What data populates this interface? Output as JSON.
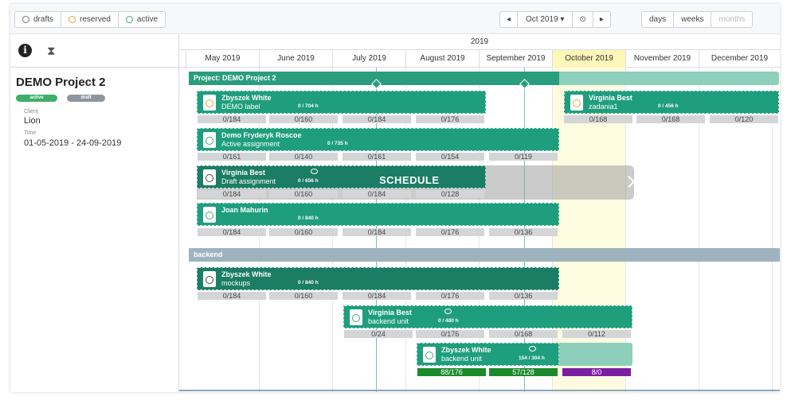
{
  "filters": {
    "drafts": "drafts",
    "reserved": "reserved",
    "active": "active"
  },
  "navigation": {
    "prev": "◂",
    "period": "Oct 2019 ▾",
    "today": "⊙",
    "next": "▸"
  },
  "zoom": {
    "days": "days",
    "weeks": "weeks",
    "months": "months"
  },
  "project": {
    "title": "DEMO Project 2",
    "status_active": "active",
    "status_draft": "draft",
    "client_label": "Client",
    "client": "Lion",
    "time_label": "Time",
    "time": "01-05-2019 - 24-09-2019"
  },
  "timeline": {
    "year": "2019",
    "months": [
      "May 2019",
      "June 2019",
      "July 2019",
      "August 2019",
      "September 2019",
      "October 2019",
      "November 2019",
      "December 2019"
    ]
  },
  "bars": {
    "project": "Project: DEMO Project 2",
    "section": "backend",
    "schedule": "SCHEDULE"
  },
  "assignments": [
    {
      "name": "Zbyszek White",
      "label": "DEMO label",
      "hours": "0 / 704 h",
      "status": "reserved"
    },
    {
      "name": "Virginia Best",
      "label": "zadania1",
      "hours": "0 / 456 h",
      "status": "reserved"
    },
    {
      "name": "Demo Fryderyk Roscoe",
      "label": "Active assignment",
      "hours": "0 / 735 h",
      "status": "active"
    },
    {
      "name": "Virginia Best",
      "label": "Draft assignment",
      "hours": "0 / 656 h",
      "status": "draft"
    },
    {
      "name": "Joan Mahurin",
      "label": "",
      "hours": "0 / 840 h",
      "status": "active"
    },
    {
      "name": "Zbyszek White",
      "label": "mockups",
      "hours": "0 / 840 h",
      "status": "draft"
    },
    {
      "name": "Virginia Best",
      "label": "backend unit",
      "hours": "0 / 480 h",
      "status": "active"
    },
    {
      "name": "Zbyszek White",
      "label": "backend unit",
      "hours": "154 / 304 h",
      "status": "active"
    }
  ],
  "capacity": {
    "row1a": [
      "0/184",
      "0/160",
      "0/184",
      "0/176"
    ],
    "row1b": [
      "0/168",
      "0/168",
      "0/120"
    ],
    "row2": [
      "0/161",
      "0/140",
      "0/161",
      "0/154",
      "0/119"
    ],
    "row3": [
      "0/184",
      "0/160",
      "0/184",
      "0/128"
    ],
    "row4": [
      "0/184",
      "0/160",
      "0/184",
      "0/176",
      "0/136"
    ],
    "row5": [
      "0/184",
      "0/160",
      "0/184",
      "0/176",
      "0/136"
    ],
    "row6": [
      "0/24",
      "0/176",
      "0/168",
      "0/112"
    ],
    "row7": [
      "88/176",
      "57/128",
      "8/0"
    ]
  },
  "colors": {
    "accent": "#1f9e7e",
    "reserved": "#e2a83c",
    "active": "#3fae6b",
    "draft": "#8d969d",
    "current_month": "#fdf7b8"
  }
}
